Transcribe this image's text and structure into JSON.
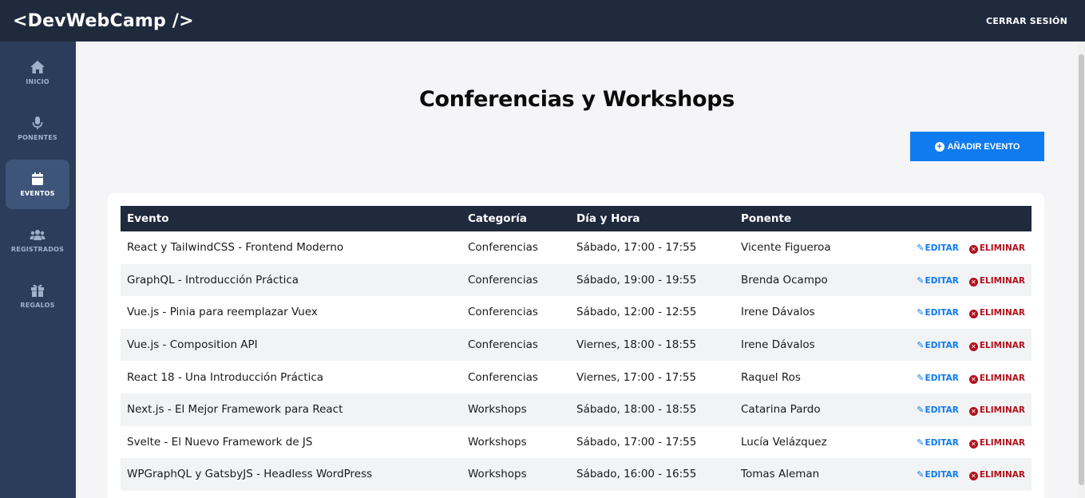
{
  "header": {
    "logo": "<DevWebCamp />",
    "logout": "CERRAR SESIÓN"
  },
  "sidebar": {
    "items": [
      {
        "label": "INICIO",
        "icon": "home-icon"
      },
      {
        "label": "PONENTES",
        "icon": "microphone-icon"
      },
      {
        "label": "EVENTOS",
        "icon": "calendar-icon",
        "active": true
      },
      {
        "label": "REGISTRADOS",
        "icon": "users-icon"
      },
      {
        "label": "REGALOS",
        "icon": "gift-icon"
      }
    ]
  },
  "main": {
    "title": "Conferencias y Workshops",
    "add_button": "AÑADIR EVENTO",
    "table": {
      "headers": [
        "Evento",
        "Categoría",
        "Día y Hora",
        "Ponente",
        ""
      ],
      "edit_label": "EDITAR",
      "delete_label": "ELIMINAR",
      "rows": [
        {
          "evento": "React y TailwindCSS - Frontend Moderno",
          "categoria": "Conferencias",
          "dia": "Sábado, 17:00 - 17:55",
          "ponente": "Vicente Figueroa"
        },
        {
          "evento": "GraphQL - Introducción Práctica",
          "categoria": "Conferencias",
          "dia": "Sábado, 19:00 - 19:55",
          "ponente": "Brenda Ocampo"
        },
        {
          "evento": "Vue.js - Pinia para reemplazar Vuex",
          "categoria": "Conferencias",
          "dia": "Sábado, 12:00 - 12:55",
          "ponente": "Irene Dávalos"
        },
        {
          "evento": "Vue.js - Composition API",
          "categoria": "Conferencias",
          "dia": "Viernes, 18:00 - 18:55",
          "ponente": "Irene Dávalos"
        },
        {
          "evento": "React 18 - Una Introducción Práctica",
          "categoria": "Conferencias",
          "dia": "Viernes, 17:00 - 17:55",
          "ponente": "Raquel Ros"
        },
        {
          "evento": "Next.js - El Mejor Framework para React",
          "categoria": "Workshops",
          "dia": "Sábado, 18:00 - 18:55",
          "ponente": "Catarina Pardo"
        },
        {
          "evento": "Svelte - El Nuevo Framework de JS",
          "categoria": "Workshops",
          "dia": "Sábado, 17:00 - 17:55",
          "ponente": "Lucía Velázquez"
        },
        {
          "evento": "WPGraphQL y GatsbyJS - Headless WordPress",
          "categoria": "Workshops",
          "dia": "Sábado, 16:00 - 16:55",
          "ponente": "Tomas Aleman"
        }
      ]
    }
  },
  "colors": {
    "topbar": "#1f2a3d",
    "sidebar": "#2c3d5b",
    "accent": "#0f7bf0",
    "danger": "#b1121c"
  }
}
